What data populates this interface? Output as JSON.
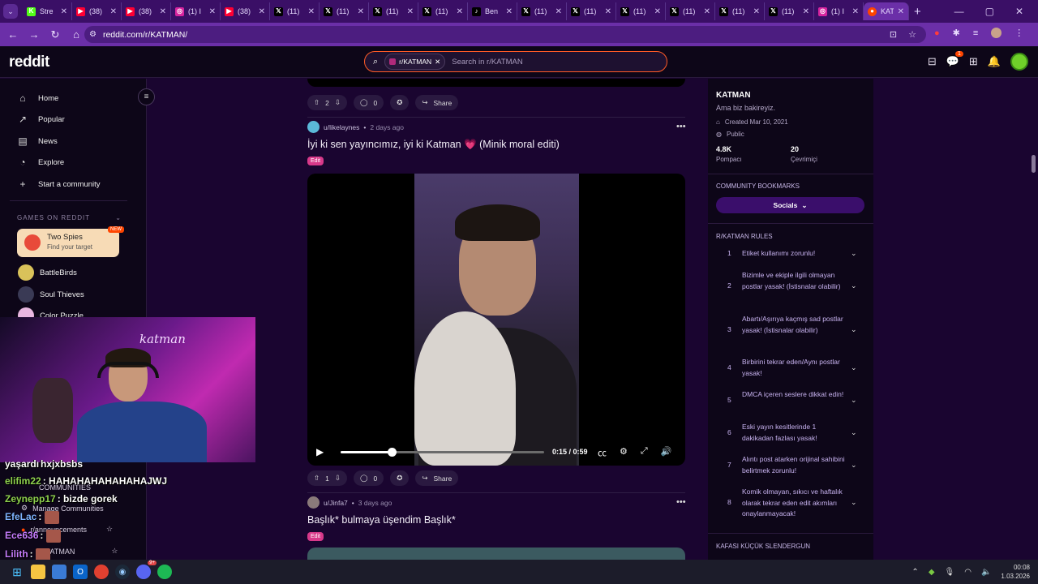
{
  "browser": {
    "tabs": [
      {
        "title": "Stre",
        "icon": "kick-icon",
        "color": "#53fc18",
        "glyph": "K"
      },
      {
        "title": "(38)",
        "icon": "youtube-icon",
        "color": "#ff0033",
        "glyph": "▶"
      },
      {
        "title": "(38)",
        "icon": "youtube-icon",
        "color": "#ff0033",
        "glyph": "▶"
      },
      {
        "title": "(1) I",
        "icon": "instagram-icon",
        "color": "#d6249f",
        "glyph": "◎"
      },
      {
        "title": "(38)",
        "icon": "youtube-icon",
        "color": "#ff0033",
        "glyph": "▶"
      },
      {
        "title": "(11)",
        "icon": "x-icon",
        "color": "#000000",
        "glyph": "𝕏"
      },
      {
        "title": "(11)",
        "icon": "x-icon",
        "color": "#000000",
        "glyph": "𝕏"
      },
      {
        "title": "(11)",
        "icon": "x-icon",
        "color": "#000000",
        "glyph": "𝕏"
      },
      {
        "title": "(11)",
        "icon": "x-icon",
        "color": "#000000",
        "glyph": "𝕏"
      },
      {
        "title": "Ben",
        "icon": "tiktok-icon",
        "color": "#000000",
        "glyph": "♪"
      },
      {
        "title": "(11)",
        "icon": "x-icon",
        "color": "#000000",
        "glyph": "𝕏"
      },
      {
        "title": "(11)",
        "icon": "x-icon",
        "color": "#000000",
        "glyph": "𝕏"
      },
      {
        "title": "(11)",
        "icon": "x-icon",
        "color": "#000000",
        "glyph": "𝕏"
      },
      {
        "title": "(11)",
        "icon": "x-icon",
        "color": "#000000",
        "glyph": "𝕏"
      },
      {
        "title": "(11)",
        "icon": "x-icon",
        "color": "#000000",
        "glyph": "𝕏"
      },
      {
        "title": "(11)",
        "icon": "x-icon",
        "color": "#000000",
        "glyph": "𝕏"
      },
      {
        "title": "(1) I",
        "icon": "instagram-icon",
        "color": "#d6249f",
        "glyph": "◎"
      }
    ],
    "active_tab": {
      "title": "KAT",
      "icon": "reddit-icon",
      "color": "#ff4500"
    },
    "url": "reddit.com/r/KATMAN/"
  },
  "reddit": {
    "logo": "reddit",
    "search_chip": "r/KATMAN",
    "search_placeholder": "Search in r/KATMAN",
    "notif_count": "1"
  },
  "sidebar": {
    "nav": [
      {
        "label": "Home",
        "icon": "home-icon",
        "glyph": "⌂"
      },
      {
        "label": "Popular",
        "icon": "popular-icon",
        "glyph": "↗"
      },
      {
        "label": "News",
        "icon": "news-icon",
        "glyph": "▤"
      },
      {
        "label": "Explore",
        "icon": "explore-icon",
        "glyph": "◔"
      },
      {
        "label": "Start a community",
        "icon": "plus-icon",
        "glyph": "+"
      }
    ],
    "games_header": "GAMES ON REDDIT",
    "featured_game": {
      "title": "Two Spies",
      "subtitle": "Find your target",
      "badge": "NEW"
    },
    "games": [
      {
        "label": "BattleBirds",
        "color": "#d9c25a"
      },
      {
        "label": "Soul Thieves",
        "color": "#3a3a55"
      },
      {
        "label": "Color Puzzle",
        "color": "#e8b7e0"
      }
    ],
    "ghost": {
      "communities": "COMMUNITIES",
      "manage": "Manage Communities",
      "announcements": "r/announcements",
      "katman": "r/KATMAN"
    }
  },
  "feed": {
    "top_actions": {
      "votes": "2",
      "comments": "0",
      "share": "Share"
    },
    "post1": {
      "author": "u/likelaynes",
      "time": "2 days ago",
      "title": "İyi ki sen yayıncımız, iyi ki Katman 💗 (Minik moral editi)",
      "flair": "Edit",
      "video_time": "0:15 / 0:59",
      "progress": 0.25,
      "votes": "1",
      "comments": "0",
      "share": "Share"
    },
    "post2": {
      "author": "u/Jinfa7",
      "time": "3 days ago",
      "title": "Başlık* bulmaya üşendim Başlık*",
      "flair": "Edit"
    }
  },
  "community": {
    "name": "KATMAN",
    "description": "Ama biz bakireyiz.",
    "created": "Created Mar 10, 2021",
    "visibility": "Public",
    "members": "4.8K",
    "members_label": "Pompacı",
    "online": "20",
    "online_label": "Çevrimiçi",
    "bookmarks_header": "COMMUNITY BOOKMARKS",
    "socials": "Socials",
    "rules_header": "R/KATMAN RULES",
    "rules": [
      "Etiket kullanımı zorunlu!",
      "Bizimle ve ekiple ilgili olmayan postlar yasak! (İstisnalar olabilir)",
      "Abartı/Aşırıya kaçmış sad postlar yasak! (İstisnalar olabilir)",
      "Birbirini tekrar eden/Aynı postlar yasak!",
      "DMCA içeren seslere dikkat edin!",
      "Eski yayın kesitlerinde 1 dakikadan fazlası yasak!",
      "Alıntı post atarken orijinal sahibini belirtmek zorunlu!",
      "Komik olmayan, sıkıcı ve haftalık olarak tekrar eden edit akımları onaylanmayacak!"
    ],
    "next_header": "KAFASI KÜÇÜK SLENDERGUN"
  },
  "stream": {
    "neon_text": "katman",
    "chat": [
      {
        "user": "yaşardı",
        "text": "hxjxbsbs",
        "color": "#ffffff",
        "emote": false
      },
      {
        "user": "elifim22",
        "text": ": HAHAHAHAHAHAHAJWJ",
        "color": "#8fd14f",
        "emote": false
      },
      {
        "user": "Zeynepp17",
        "text": ": bizde gorek",
        "color": "#8fd14f",
        "emote": false
      },
      {
        "user": "EfeLac",
        "text": ":",
        "color": "#7fb2ff",
        "emote": true
      },
      {
        "user": "Ece636",
        "text": ":",
        "color": "#c77dff",
        "emote": true
      },
      {
        "user": "Lilith",
        "text": ":",
        "color": "#c77dff",
        "emote": true
      }
    ]
  },
  "taskbar": {
    "time": "00:08",
    "date": "1.03.2026",
    "discord_badge": "9+"
  }
}
